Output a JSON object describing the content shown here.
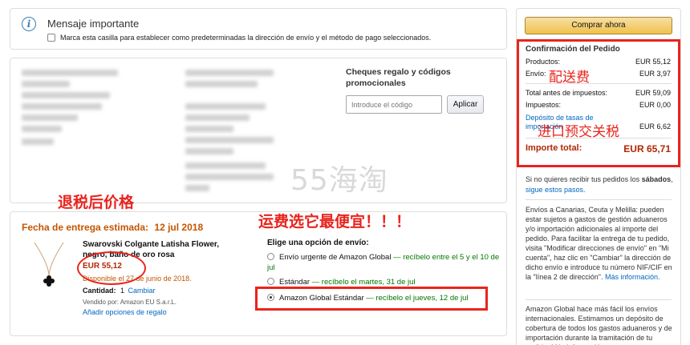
{
  "notice": {
    "info_icon": "info-icon",
    "title": "Mensaje importante",
    "checkbox_label": "Marca esta casilla para establecer como predeterminadas la dirección de envío y el método de pago seleccionados."
  },
  "gift": {
    "heading": "Cheques regalo y códigos promocionales",
    "placeholder": "Introduce el código",
    "apply_label": "Aplicar"
  },
  "watermark": "55海淘",
  "delivery": {
    "date_label": "Fecha de entrega estimada:",
    "date_value": "12 jul 2018",
    "product_name": "Swarovski Colgante Latisha Flower, negro, baño de oro rosa",
    "price": "EUR 55,12",
    "availability": "Disponible el 27 de junio de 2018.",
    "qty_label": "Cantidad:",
    "qty_value": "1",
    "qty_change": "Cambiar",
    "seller": "Vendido por: Amazon EU S.a.r.L.",
    "gift_options": "Añadir opciones de regalo",
    "shipping_heading": "Elige una opción de envío:",
    "options": [
      {
        "name": "Envío urgente de Amazon Global",
        "detail": "— recíbelo entre el 5 y el 10 de jul",
        "selected": false
      },
      {
        "name": "Estándar",
        "detail": "— recíbelo el martes, 31 de jul",
        "selected": false
      },
      {
        "name": "Amazon Global Estándar",
        "detail": "— recíbelo el jueves, 12 de jul",
        "selected": true
      }
    ]
  },
  "annotations": {
    "tax_refund_price": "退税后价格",
    "cheapest_shipping": "运费选它最便宜！！！",
    "shipping_fee": "配送费",
    "import_deposit": "进口预交关税"
  },
  "summary": {
    "buy_button": "Comprar ahora",
    "title": "Confirmación del Pedido",
    "products_label": "Productos:",
    "products_value": "EUR 55,12",
    "shipping_label": "Envío:",
    "shipping_value": "EUR 3,97",
    "pretax_label": "Total antes de impuestos:",
    "pretax_value": "EUR 59,09",
    "tax_label": "Impuestos:",
    "tax_value": "EUR 0,00",
    "deposit_label_1": "Depósito de tasas de",
    "deposit_label_2": "importación",
    "deposit_value": "EUR 6,62",
    "total_label": "Importe total:",
    "total_value": "EUR 65,71"
  },
  "sidebar": {
    "saturday_text_1": "Si no quieres recibir tus pedidos los",
    "saturday_bold": "sábados",
    "saturday_link": "sigue estos pasos.",
    "canarias_text": "Envíos a Canarias, Ceuta y Melilla: pueden estar sujetos a gastos de gestión aduaneros y/o importación adicionales al importe del pedido. Para facilitar la entrega de tu pedido, visita \"Modificar direcciones de envío\" en \"Mi cuenta\", haz clic en \"Cambiar\" la dirección de dicho envío e introduce tu número NIF/CIF en la \"línea 2 de dirección\".",
    "more_info": "Más información.",
    "global_text": "Amazon Global hace más fácil los envíos internacionales. Estimamos un depósito de cobertura de todos los gastos aduaneros y de importación durante la tramitación de tu pedido. Más información"
  }
}
